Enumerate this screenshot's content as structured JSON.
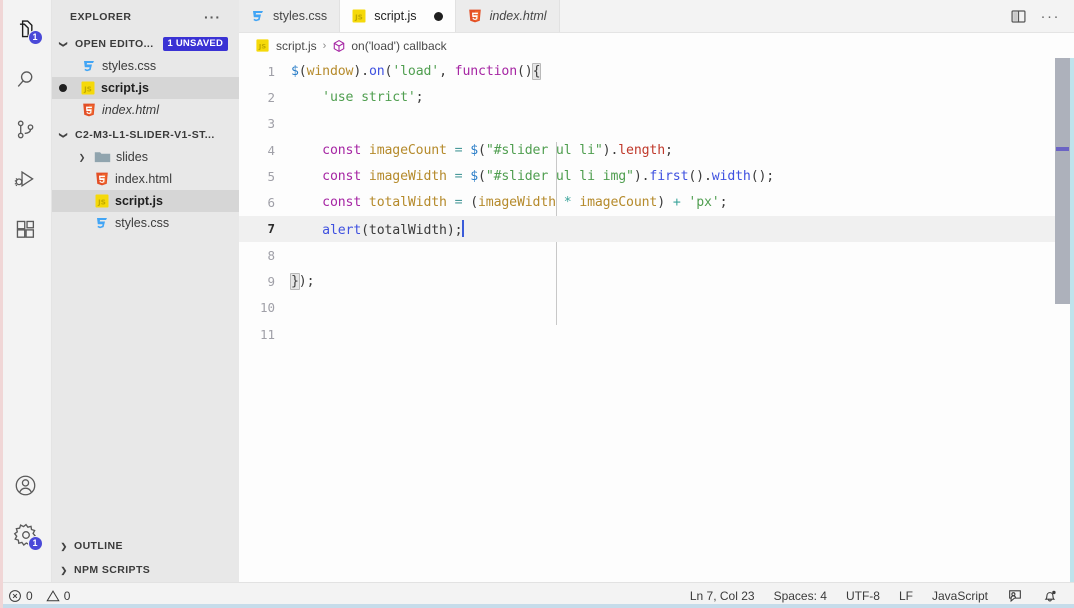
{
  "activity_bar": {
    "items": [
      {
        "name": "explorer",
        "icon": "files-icon",
        "badge": "1",
        "active": true
      },
      {
        "name": "search",
        "icon": "search-icon",
        "badge": null,
        "active": false
      },
      {
        "name": "source-control",
        "icon": "source-control-icon",
        "badge": null,
        "active": false
      },
      {
        "name": "run-and-debug",
        "icon": "run-debug-icon",
        "badge": null,
        "active": false
      },
      {
        "name": "extensions",
        "icon": "extensions-icon",
        "badge": null,
        "active": false
      }
    ],
    "bottom_items": [
      {
        "name": "accounts",
        "icon": "account-icon",
        "badge": null
      },
      {
        "name": "manage",
        "icon": "gear-icon",
        "badge": "1"
      }
    ]
  },
  "sidebar": {
    "title": "EXPLORER",
    "more_actions": "···",
    "open_editors": {
      "label": "OPEN EDITO...",
      "badge": "1 UNSAVED",
      "expanded": true,
      "items": [
        {
          "label": "styles.css",
          "icon": "css-icon",
          "dirty": false,
          "italic": false,
          "selected": false
        },
        {
          "label": "script.js",
          "icon": "js-icon",
          "dirty": true,
          "italic": false,
          "selected": true
        },
        {
          "label": "index.html",
          "icon": "html-icon",
          "dirty": false,
          "italic": true,
          "selected": false
        }
      ]
    },
    "folder": {
      "label": "C2-M3-L1-SLIDER-V1-ST...",
      "expanded": true,
      "items": [
        {
          "label": "slides",
          "icon": "folder-icon",
          "kind": "folder",
          "expanded": false,
          "selected": false
        },
        {
          "label": "index.html",
          "icon": "html-icon",
          "kind": "file",
          "selected": false
        },
        {
          "label": "script.js",
          "icon": "js-icon",
          "kind": "file",
          "selected": true
        },
        {
          "label": "styles.css",
          "icon": "css-icon",
          "kind": "file",
          "selected": false
        }
      ]
    },
    "bottom_sections": [
      {
        "label": "OUTLINE",
        "expanded": false
      },
      {
        "label": "NPM SCRIPTS",
        "expanded": false
      }
    ]
  },
  "tabs": [
    {
      "label": "styles.css",
      "icon": "css-icon",
      "active": false,
      "dirty": false,
      "italic": false
    },
    {
      "label": "script.js",
      "icon": "js-icon",
      "active": true,
      "dirty": true,
      "italic": false
    },
    {
      "label": "index.html",
      "icon": "html-icon",
      "active": false,
      "dirty": false,
      "italic": true
    }
  ],
  "tabbar_actions": [
    {
      "name": "split-editor-icon",
      "label": "split-editor"
    },
    {
      "name": "more-actions-icon",
      "label": "···"
    }
  ],
  "breadcrumb": {
    "file": "script.js",
    "separator": "›",
    "symbol": "on('load') callback",
    "symbol_icon": "cube-icon"
  },
  "editor": {
    "language": "JavaScript",
    "line_numbers": [
      "1",
      "2",
      "3",
      "4",
      "5",
      "6",
      "7",
      "8",
      "9",
      "10",
      "11"
    ],
    "active_line": 7,
    "lines": [
      "$(window).on('load', function(){",
      "    'use strict';",
      "",
      "    const imageCount = $(\"#slider ul li\").length;",
      "    const imageWidth = $(\"#slider ul li img\").first().width();",
      "    const totalWidth = (imageWidth * imageCount) + 'px';",
      "    alert(totalWidth);",
      "",
      "});",
      "",
      ""
    ]
  },
  "status_bar": {
    "left": [
      {
        "name": "errors",
        "icon": "error-icon",
        "value": "0"
      },
      {
        "name": "warnings",
        "icon": "warning-icon",
        "value": "0"
      }
    ],
    "right": [
      {
        "name": "cursor-position",
        "label": "Ln 7, Col 23"
      },
      {
        "name": "indentation",
        "label": "Spaces: 4"
      },
      {
        "name": "encoding",
        "label": "UTF-8"
      },
      {
        "name": "eol",
        "label": "LF"
      },
      {
        "name": "language-mode",
        "label": "JavaScript"
      },
      {
        "name": "feedback-icon",
        "label": ""
      },
      {
        "name": "notifications-icon",
        "label": ""
      }
    ]
  },
  "colors": {
    "accent_badge": "#3a32d4",
    "activity_badge": "#4a49d8",
    "sidebar_bg": "#e8e8e8",
    "editor_bg": "#fdfdfd",
    "cursor": "#3a5bd9",
    "scrollbar": "#adb1bb"
  }
}
